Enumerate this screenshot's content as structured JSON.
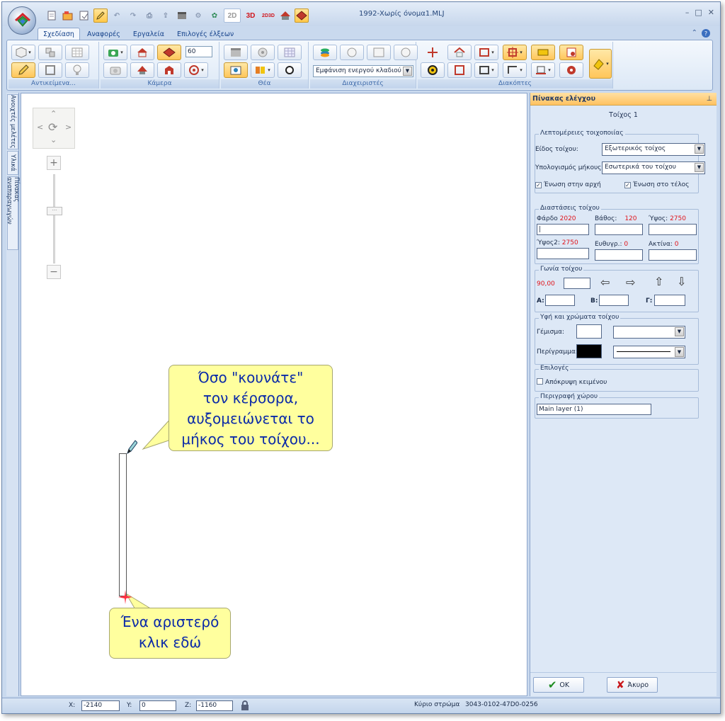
{
  "window": {
    "title": "1992-Χωρίς όνομα1.MLJ",
    "controls": {
      "minimize": "–",
      "maximize": "□",
      "close": "✕"
    }
  },
  "quick_access": {
    "btn_2d": "2D",
    "btn_3d": "3D",
    "btn_23": "2D3D"
  },
  "ribbon": {
    "tabs": [
      "Σχεδίαση",
      "Αναφορές",
      "Εργαλεία",
      "Επιλογές έλξεων"
    ],
    "active_tab": 0,
    "groups": {
      "objects": "Αντικείμενα...",
      "camera": "Κάμερα",
      "view": "Θέα",
      "managers": "Διαχειριστές",
      "switches": "Διακόπτες"
    },
    "camera_angle_value": "60",
    "branch_display": "Εμφάνιση ενεργού κλαδιού"
  },
  "side_tabs": [
    "Ανοιχτές μελέτες",
    "Υλικά",
    "Πίνακας αναπαραγωγών"
  ],
  "canvas": {
    "bubble_top": [
      "Όσο \"κουνάτε\"",
      "τον κέρσορα,",
      "αυξομειώνεται το",
      "μήκος του τοίχου..."
    ],
    "bubble_bottom": [
      "Ένα αριστερό",
      "κλικ εδώ"
    ]
  },
  "panel": {
    "title": "Πίνακας ελέγχου",
    "subtitle": "Τοίχος 1",
    "wall_details": {
      "legend": "Λεπτομέρειες τοιχοποιίας",
      "type_label": "Είδος τοίχου:",
      "type_value": "Εξωτερικός τοίχος",
      "length_label": "Υπολογισμός μήκους:",
      "length_value": "Εσωτερικά του τοίχου",
      "join_start": "Ένωση στην αρχή",
      "join_end": "Ένωση στο τέλος",
      "join_start_checked": true,
      "join_end_checked": true
    },
    "dimensions": {
      "legend": "Διαστάσεις τοίχου",
      "load_label": "Φάρδο",
      "load_value": "2020",
      "depth_label": "Βάθος:",
      "depth_value": "120",
      "height_label": "Ύψος:",
      "height_value": "2750",
      "height2_label": "Ύψος2:",
      "height2_value": "2750",
      "straight_label": "Ευθυγρ.:",
      "straight_value": "0",
      "radius_label": "Ακτίνα:",
      "radius_value": "0"
    },
    "angle": {
      "legend": "Γωνία τοίχου",
      "value": "90,00",
      "a_label": "A:",
      "b_label": "B:",
      "g_label": "Γ:"
    },
    "textures": {
      "legend": "Υφή και χρώματα τοίχου",
      "fill_label": "Γέμισμα:",
      "outline_label": "Περίγραμμα:",
      "fill_color": "#ffffff",
      "outline_color": "#000000"
    },
    "options": {
      "legend": "Επιλογές",
      "hide_text": "Απόκρυψη κειμένου",
      "hide_text_checked": false
    },
    "space": {
      "legend": "Περιγραφή χώρου",
      "value": "Main layer (1)"
    },
    "ok_label": "OK",
    "cancel_label": "Άκυρο"
  },
  "statusbar": {
    "x_label": "X:",
    "x_value": "-2140",
    "y_label": "Y:",
    "y_value": "0",
    "z_label": "Z:",
    "z_value": "-1160",
    "layer_label": "Κύριο στρώμα",
    "layer_code": "3043-0102-47D0-0256"
  },
  "colors": {
    "accent": "#ffc261",
    "bubble": "#ffff9e",
    "bubble_text": "#0b2aa8",
    "dimension_red": "#e0141b"
  }
}
